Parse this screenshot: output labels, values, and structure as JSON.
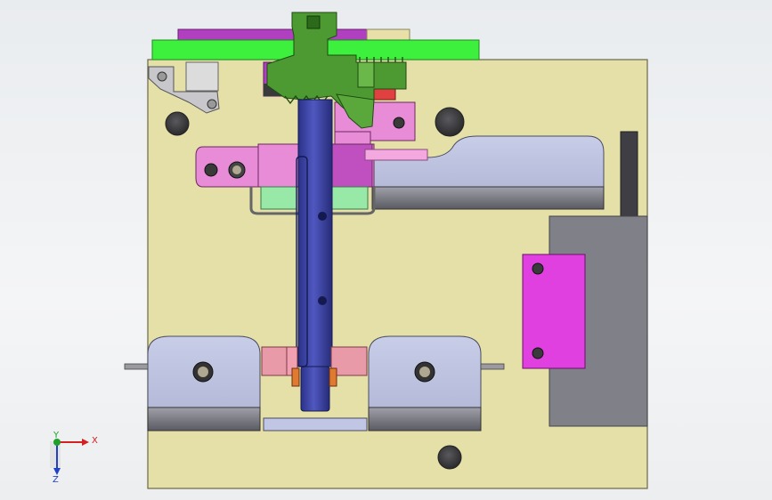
{
  "viewport": {
    "background_top": "#e9ecef",
    "background_bottom": "#f4f5f6"
  },
  "triad": {
    "x_label": "X",
    "y_label": "Y",
    "z_label": "Z",
    "x_color": "#d42020",
    "y_color": "#1fa02a",
    "z_color": "#2040c8"
  },
  "colors": {
    "base_plate": "#e4e0a8",
    "green_bar": "#3df03d",
    "shaft": "#3c46a8",
    "magenta": "#e040e0",
    "pink": "#e88cd8",
    "lavender": "#c0c6e4",
    "gray_block": "#808088",
    "gear_green": "#4e9a32"
  }
}
